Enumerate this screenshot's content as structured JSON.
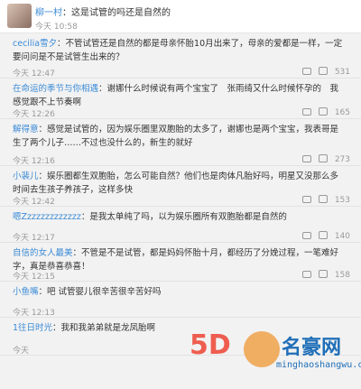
{
  "header": {
    "user": "柳一村",
    "text": "：这是试管的吗还是自然的",
    "time": "今天 10:58"
  },
  "comments": [
    {
      "user": "cecilia雪夕",
      "text": "：不管试管还是自然的都是母亲怀胎10月出来了，母亲的爱都是一样，一定要问问是不是试管生出来的？",
      "time": "今天 12:47",
      "likes": "531"
    },
    {
      "user": "在命运的季节与你相遇",
      "text": "：谢娜什么时候说有两个宝宝了　张雨绮又什么时候怀孕的　我感觉跟不上节奏啊",
      "time": "今天 12:26",
      "likes": "165"
    },
    {
      "user": "解得意",
      "text": "：感觉是试管的，因为娱乐圈里双胞胎的太多了，谢娜也是两个宝宝，我表哥是生了两个儿子……不过也没什么的，新生的就好",
      "time": "今天 12:16",
      "likes": "273"
    },
    {
      "user": "小裴儿",
      "text": "：娱乐圈都生双胞胎，怎么可能自然？他们也是肉体凡胎好吗，明星又没那么多时间去生孩子养孩子，这样多快",
      "time": "今天 12:42",
      "likes": "153"
    },
    {
      "user": "嗯Zzzzzzzzzzzzz",
      "text": "：是我太单纯了吗，以为娱乐圈所有双胞胎都是自然的",
      "time": "今天 12:17",
      "likes": "140"
    },
    {
      "user": "自信的女人最美",
      "text": "：不管是不是试管，都是妈妈怀胎十月，都经历了分娩过程，一笔难好字，真是恭喜恭喜！",
      "time": "今天 12:15",
      "likes": "158"
    },
    {
      "user": "小鱼嘴",
      "text": "：吧 试管婴儿很辛苦很辛苦好吗",
      "time": "今天 12:13",
      "likes": ""
    },
    {
      "user": "1往日时光",
      "text": "：我和我弟弟就是龙凤胎啊",
      "time": "今天",
      "likes": ""
    }
  ],
  "watermark": {
    "brand": "5D",
    "name": "名豪网",
    "url": "minghaoshangwu.com"
  }
}
